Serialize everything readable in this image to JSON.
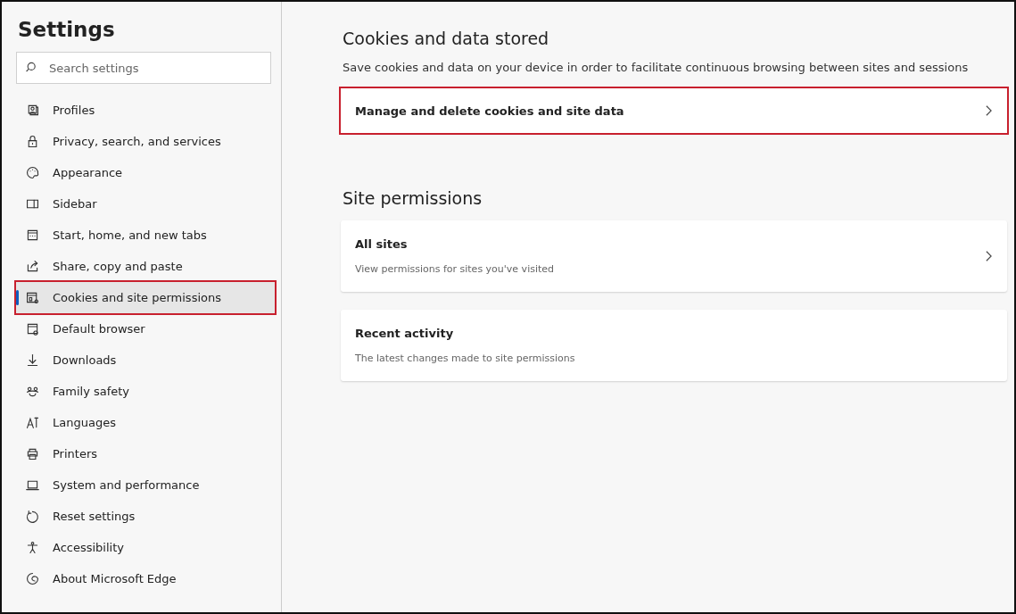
{
  "sidebar": {
    "title": "Settings",
    "search": {
      "placeholder": "Search settings"
    },
    "items": [
      {
        "label": "Profiles",
        "selected": false,
        "highlighted": false
      },
      {
        "label": "Privacy, search, and services",
        "selected": false,
        "highlighted": false
      },
      {
        "label": "Appearance",
        "selected": false,
        "highlighted": false
      },
      {
        "label": "Sidebar",
        "selected": false,
        "highlighted": false
      },
      {
        "label": "Start, home, and new tabs",
        "selected": false,
        "highlighted": false
      },
      {
        "label": "Share, copy and paste",
        "selected": false,
        "highlighted": false
      },
      {
        "label": "Cookies and site permissions",
        "selected": true,
        "highlighted": true
      },
      {
        "label": "Default browser",
        "selected": false,
        "highlighted": false
      },
      {
        "label": "Downloads",
        "selected": false,
        "highlighted": false
      },
      {
        "label": "Family safety",
        "selected": false,
        "highlighted": false
      },
      {
        "label": "Languages",
        "selected": false,
        "highlighted": false
      },
      {
        "label": "Printers",
        "selected": false,
        "highlighted": false
      },
      {
        "label": "System and performance",
        "selected": false,
        "highlighted": false
      },
      {
        "label": "Reset settings",
        "selected": false,
        "highlighted": false
      },
      {
        "label": "Accessibility",
        "selected": false,
        "highlighted": false
      },
      {
        "label": "About Microsoft Edge",
        "selected": false,
        "highlighted": false
      }
    ]
  },
  "sections": [
    {
      "title": "Cookies and data stored",
      "description": "Save cookies and data on your device in order to facilitate continuous browsing between sites and sessions",
      "rows": [
        {
          "label": "Manage and delete cookies and site data",
          "highlighted": true,
          "chevron": true
        }
      ]
    },
    {
      "title": "Site permissions",
      "rows": [
        {
          "label": "All sites",
          "subtitle": "View permissions for sites you've visited",
          "highlighted": false,
          "chevron": true
        },
        {
          "label": "Recent activity",
          "subtitle": "The latest changes made to site permissions",
          "highlighted": false,
          "chevron": false
        }
      ]
    }
  ]
}
